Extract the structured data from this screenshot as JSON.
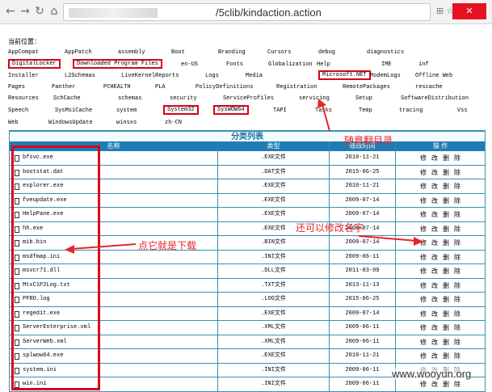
{
  "browser": {
    "url_visible": "/5clib/kindaction.action",
    "window_button": "✕"
  },
  "location_label": "当前位置：",
  "directories": [
    [
      "AppCompat",
      "AppPatch",
      "assembly",
      "Boot",
      "Branding",
      "Cursors",
      "debug",
      "diagnostics"
    ],
    [
      "DigitalLocker",
      "Downloaded Program Files",
      "en-US",
      "Fonts",
      "Globalization",
      "Help",
      "IME",
      "inf"
    ],
    [
      "Installer",
      "L2Schemas",
      "LiveKernelReports",
      "Logs",
      "Media",
      "Microsoft.NET",
      "ModemLogs",
      "Offline Web"
    ],
    [
      "Pages",
      "Panther",
      "PCHEALTH",
      "PLA",
      "PolicyDefinitions",
      "Registration",
      "RemotePackages",
      "rescache"
    ],
    [
      "Resources",
      "SchCache",
      "schemas",
      "security",
      "ServiceProfiles",
      "servicing",
      "Setup",
      "SoftwareDistribution"
    ],
    [
      "Speech",
      "SysMsiCache",
      "system",
      "System32",
      "SysWOW64",
      "TAPI",
      "Tasks",
      "Temp",
      "tracing",
      "Vss"
    ],
    [
      "Web",
      "WindowsUpdate",
      "winsxs",
      "zh-CN"
    ]
  ],
  "table": {
    "caption": "分类列表",
    "headers": [
      "名称",
      "类型",
      "修改时间",
      "操 作"
    ],
    "op_labels": [
      "修",
      "改",
      "删",
      "除"
    ],
    "rows": [
      [
        "bfsvc.exe",
        ".EXE文件",
        "2010-11-21"
      ],
      [
        "bootstat.dat",
        ".DAT文件",
        "2015-06-25"
      ],
      [
        "explorer.exe",
        ".EXE文件",
        "2010-11-21"
      ],
      [
        "fveupdate.exe",
        ".EXE文件",
        "2009-07-14"
      ],
      [
        "HelpPane.exe",
        ".EXE文件",
        "2009-07-14"
      ],
      [
        "hh.exe",
        ".EXE文件",
        "2009-07-14"
      ],
      [
        "mib.bin",
        ".BIN文件",
        "2009-07-14"
      ],
      [
        "msdfmap.ini",
        ".INI文件",
        "2009-06-11"
      ],
      [
        "msvcr71.dll",
        ".DLL文件",
        "2011-03-09"
      ],
      [
        "MtxC1P2Log.txt",
        ".TXT文件",
        "2013-11-13"
      ],
      [
        "PFRO.log",
        ".LOG文件",
        "2015-06-25"
      ],
      [
        "regedit.exe",
        ".EXE文件",
        "2009-07-14"
      ],
      [
        "ServerEnterprise.xml",
        ".XML文件",
        "2009-06-11"
      ],
      [
        "ServerWeb.xml",
        ".XML文件",
        "2009-06-11"
      ],
      [
        "splwow64.exe",
        ".EXE文件",
        "2010-11-21"
      ],
      [
        "system.ini",
        ".INI文件",
        "2009-06-11"
      ],
      [
        "win.ini",
        ".INI文件",
        "2009-06-11"
      ]
    ]
  },
  "annotations": {
    "browse": "随意翻目录",
    "rename": "还可以修改名字",
    "download": "点它就是下载"
  },
  "watermark": "www.wooyun.org",
  "colors": {
    "accent": "#1f7db6",
    "annotation": "#e8252a"
  }
}
